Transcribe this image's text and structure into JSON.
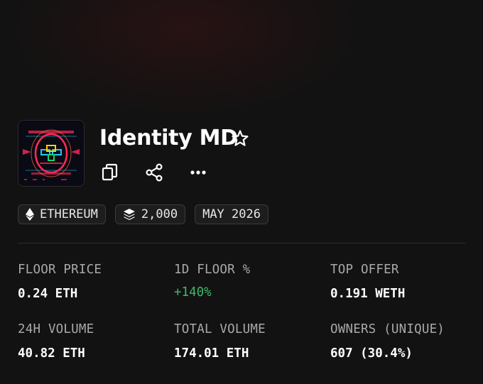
{
  "collection": {
    "name": "Identity MD",
    "avatar_icon": "cyber-face-artwork",
    "accent_colors": [
      "#ff2a55",
      "#1ec8ff",
      "#ffd400",
      "#12d66a"
    ]
  },
  "actions": [
    {
      "name": "copy-icon"
    },
    {
      "name": "share-icon"
    },
    {
      "name": "more-icon"
    }
  ],
  "chips": {
    "chain": {
      "icon": "ethereum-icon",
      "label": "ETHEREUM"
    },
    "supply": {
      "icon": "layers-icon",
      "label": "2,000"
    },
    "date": {
      "label": "MAY 2026"
    }
  },
  "stats": {
    "floor_price": {
      "label": "FLOOR PRICE",
      "value": "0.24 ETH"
    },
    "floor_change": {
      "label": "1D FLOOR %",
      "value": "+140%",
      "color": "#3fb86a"
    },
    "top_offer": {
      "label": "TOP OFFER",
      "value": "0.191 WETH"
    },
    "volume_24h": {
      "label": "24H VOLUME",
      "value": "40.82 ETH"
    },
    "total_volume": {
      "label": "TOTAL VOLUME",
      "value": "174.01 ETH"
    },
    "owners": {
      "label": "OWNERS (UNIQUE)",
      "value": "607 (30.4%)"
    }
  }
}
